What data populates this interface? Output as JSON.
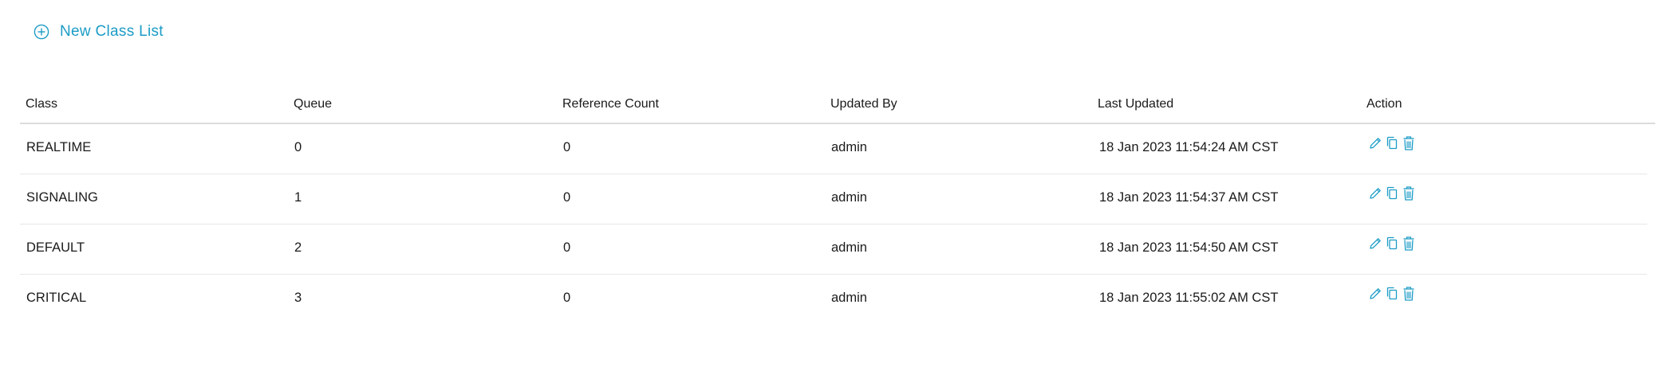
{
  "toolbar": {
    "new_label": "New Class List",
    "accent_color": "#1c9cc6"
  },
  "table": {
    "columns": [
      "Class",
      "Queue",
      "Reference Count",
      "Updated By",
      "Last Updated",
      "Action"
    ],
    "rows": [
      {
        "class": "REALTIME",
        "queue": "0",
        "reference_count": "0",
        "updated_by": "admin",
        "last_updated": "18 Jan 2023 11:54:24 AM CST"
      },
      {
        "class": "SIGNALING",
        "queue": "1",
        "reference_count": "0",
        "updated_by": "admin",
        "last_updated": "18 Jan 2023 11:54:37 AM CST"
      },
      {
        "class": "DEFAULT",
        "queue": "2",
        "reference_count": "0",
        "updated_by": "admin",
        "last_updated": "18 Jan 2023 11:54:50 AM CST"
      },
      {
        "class": "CRITICAL",
        "queue": "3",
        "reference_count": "0",
        "updated_by": "admin",
        "last_updated": "18 Jan 2023 11:55:02 AM CST"
      }
    ],
    "action_icons": [
      "edit-icon",
      "copy-icon",
      "delete-icon"
    ]
  }
}
